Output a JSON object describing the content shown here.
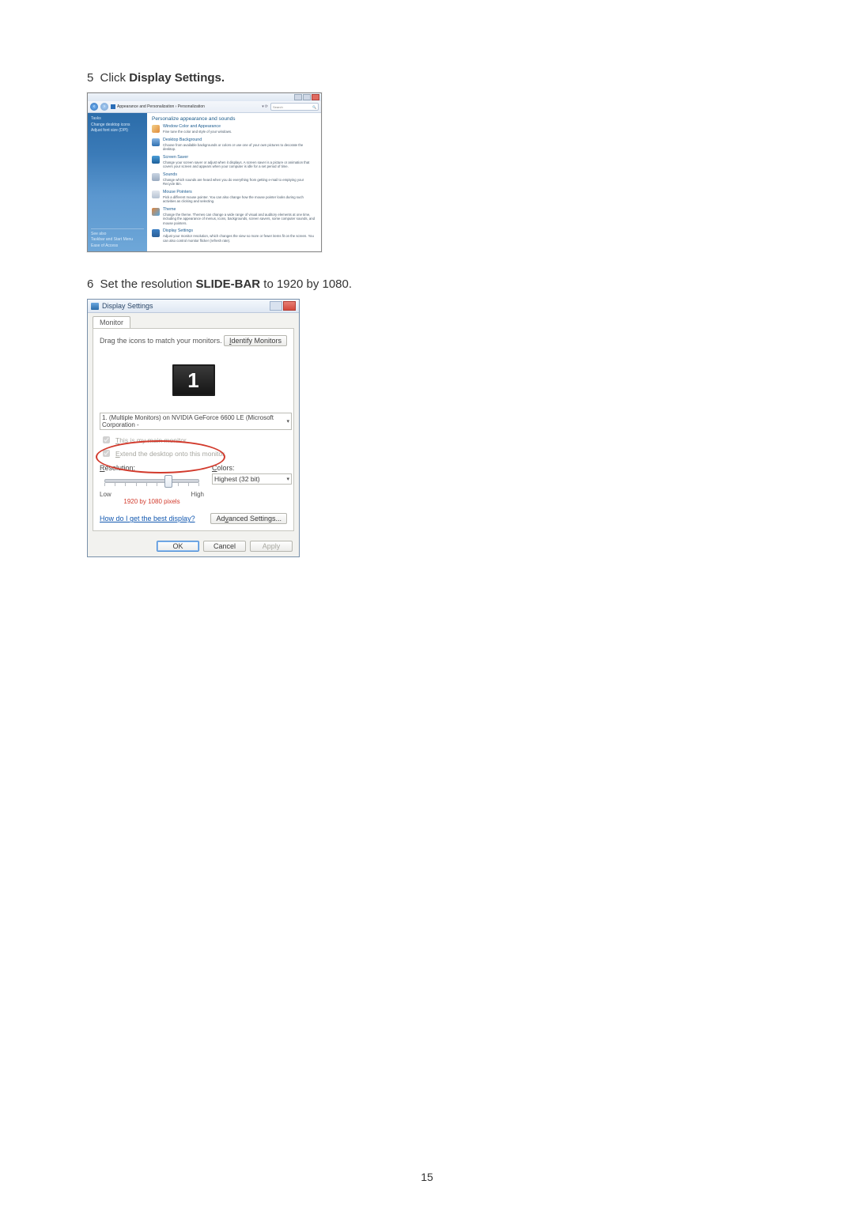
{
  "step5": {
    "num": "5",
    "pre": "Click ",
    "bold": "Display Settings."
  },
  "step6": {
    "num": "6",
    "pre": "Set the resolution ",
    "bold": "SLIDE-BAR",
    "post": " to 1920 by 1080."
  },
  "cp": {
    "breadcrumb_text": "Appearance and Personalization  ›  Personalization",
    "search_pill_text": "Search",
    "sidebar": {
      "group_title": "Tasks",
      "items": [
        "Change desktop icons",
        "Adjust font size (DPI)"
      ],
      "foot_label": "See also",
      "foot_items": [
        "Taskbar and Start Menu",
        "Ease of Access"
      ]
    },
    "heading": "Personalize appearance and sounds",
    "entries": [
      {
        "title": "Window Color and Appearance",
        "desc": "Fine tune the color and style of your windows."
      },
      {
        "title": "Desktop Background",
        "desc": "Choose from available backgrounds or colors or use one of your own pictures to decorate the desktop."
      },
      {
        "title": "Screen Saver",
        "desc": "Change your screen saver or adjust when it displays. A screen saver is a picture or animation that covers your screen and appears when your computer is idle for a set period of time."
      },
      {
        "title": "Sounds",
        "desc": "Change which sounds are heard when you do everything from getting e-mail to emptying your Recycle Bin."
      },
      {
        "title": "Mouse Pointers",
        "desc": "Pick a different mouse pointer. You can also change how the mouse pointer looks during such activities as clicking and selecting."
      },
      {
        "title": "Theme",
        "desc": "Change the theme. Themes can change a wide range of visual and auditory elements at one time, including the appearance of menus, icons, backgrounds, screen savers, some computer sounds, and mouse pointers."
      },
      {
        "title": "Display Settings",
        "desc": "Adjust your monitor resolution, which changes the view so more or fewer items fit on the screen. You can also control monitor flicker (refresh rate)."
      }
    ]
  },
  "ds": {
    "title": "Display Settings",
    "tab": "Monitor",
    "instruction": "Drag the icons to match your monitors.",
    "identify_btn": "Identify Monitors",
    "monitor_number": "1",
    "monitor_select": "1. (Multiple Monitors) on NVIDIA GeForce 6600 LE (Microsoft Corporation -",
    "check_main": "This is my main monitor",
    "check_extend": "Extend the desktop onto this monitor",
    "res_label": "Resolution:",
    "res_low": "Low",
    "res_high": "High",
    "res_annot": "1920 by 1080 pixels",
    "color_label": "Colors:",
    "color_value": "Highest (32 bit)",
    "help_link": "How do I get the best display?",
    "adv_btn": "Advanced Settings...",
    "ok_btn": "OK",
    "cancel_btn": "Cancel",
    "apply_btn": "Apply"
  },
  "page_number": "15"
}
